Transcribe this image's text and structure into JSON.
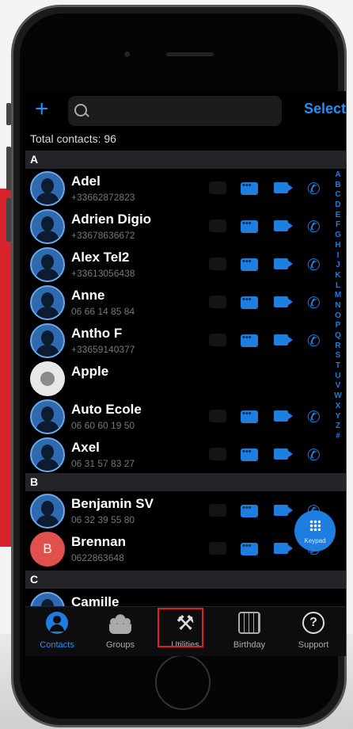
{
  "header": {
    "select_label": "Select"
  },
  "total_contacts": "Total contacts: 96",
  "sections": [
    {
      "letter": "A"
    },
    {
      "letter": "B"
    },
    {
      "letter": "C"
    }
  ],
  "contacts": [
    {
      "name": "Adel",
      "phone": "+33662872823",
      "avatar": "person"
    },
    {
      "name": "Adrien Digio",
      "phone": "+33678636672",
      "avatar": "person"
    },
    {
      "name": "Alex Tel2",
      "phone": "+33613056438",
      "avatar": "person"
    },
    {
      "name": "Anne",
      "phone": "06 66 14 85 84",
      "avatar": "person"
    },
    {
      "name": "Antho F",
      "phone": "+33659140377",
      "avatar": "person"
    },
    {
      "name": "Apple",
      "phone": "",
      "avatar": "apple"
    },
    {
      "name": "Auto Ecole",
      "phone": "06 60 60 19 50",
      "avatar": "person"
    },
    {
      "name": "Axel",
      "phone": "06 31 57 83 27",
      "avatar": "person"
    },
    {
      "name": "Benjamin SV",
      "phone": "06 32 39 55 80",
      "avatar": "person"
    },
    {
      "name": "Brennan",
      "phone": "0622863648",
      "avatar": "B"
    },
    {
      "name": "Camille",
      "phone": "",
      "avatar": "person"
    }
  ],
  "alphabet": [
    "A",
    "B",
    "C",
    "D",
    "E",
    "F",
    "G",
    "H",
    "I",
    "J",
    "K",
    "L",
    "M",
    "N",
    "O",
    "P",
    "Q",
    "R",
    "S",
    "T",
    "U",
    "V",
    "W",
    "X",
    "Y",
    "Z",
    "#"
  ],
  "fab": {
    "label": "Keypad"
  },
  "tabs": [
    {
      "label": "Contacts",
      "icon": "contacts-icon"
    },
    {
      "label": "Groups",
      "icon": "groups-icon"
    },
    {
      "label": "Utilities",
      "icon": "tools-icon"
    },
    {
      "label": "Birthday",
      "icon": "calendar-icon"
    },
    {
      "label": "Support",
      "icon": "support-icon"
    }
  ],
  "colors": {
    "accent": "#1e7ee0",
    "highlight": "#e02020",
    "background_red": "#d8232c"
  }
}
